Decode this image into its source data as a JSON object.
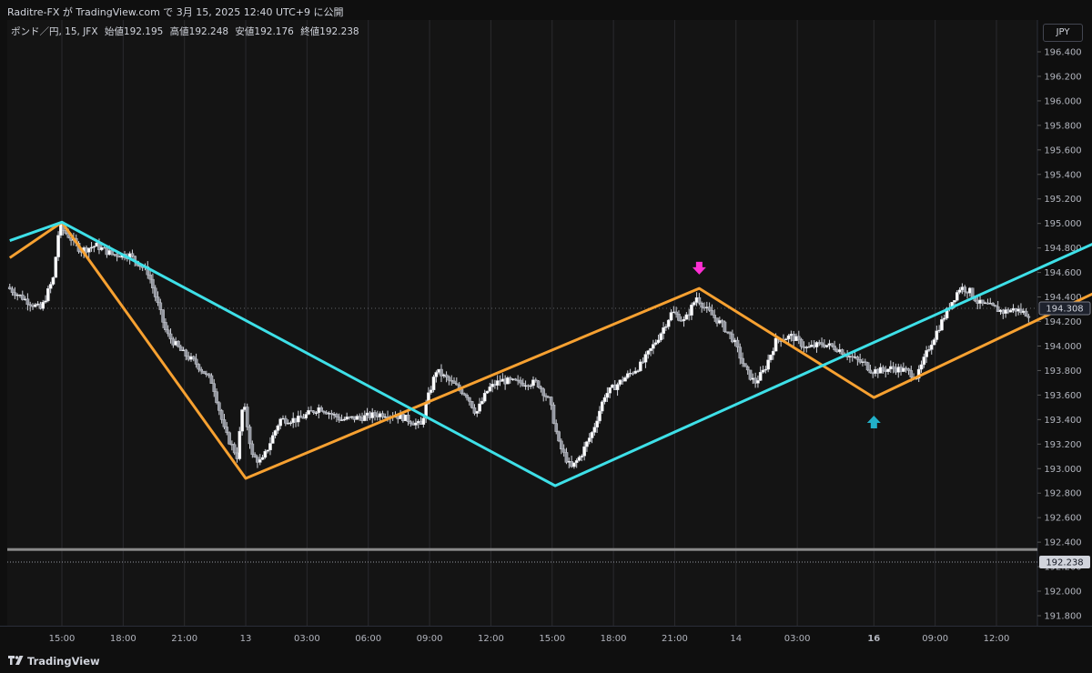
{
  "header": {
    "publish_info": "Raditre-FX が TradingView.com で 3月 15, 2025 12:40 UTC+9 に公開"
  },
  "legend": {
    "symbol": "ポンド／円, 15, JFX",
    "open": "始値192.195",
    "high": "高値192.248",
    "low": "安値192.176",
    "close": "終値192.238"
  },
  "currency_label": "JPY",
  "footer": {
    "brand": "TradingView"
  },
  "colors": {
    "background": "#141414",
    "grid": "#2a2a2e",
    "cyan_zigzag": "#3ee0e8",
    "orange_zigzag": "#f7a131",
    "marker_down": "#ff2fd4",
    "marker_up": "#22b0c8",
    "candle": "#d1d4dc",
    "hline": "#8a8a8a"
  },
  "chart_data": {
    "type": "candlestick",
    "symbol": "ポンド／円, 15, JFX",
    "ylim": [
      191.7,
      196.6
    ],
    "y_ticks": [
      "196.400",
      "196.200",
      "196.000",
      "195.800",
      "195.600",
      "195.400",
      "195.200",
      "195.000",
      "194.800",
      "194.600",
      "194.400",
      "194.200",
      "194.000",
      "193.800",
      "193.600",
      "193.400",
      "193.200",
      "193.000",
      "192.800",
      "192.600",
      "192.400",
      "192.200",
      "192.000",
      "191.800"
    ],
    "y_tick_values": [
      196.4,
      196.2,
      196.0,
      195.8,
      195.6,
      195.4,
      195.2,
      195.0,
      194.8,
      194.6,
      194.4,
      194.2,
      194.0,
      193.8,
      193.6,
      193.4,
      193.2,
      193.0,
      192.8,
      192.6,
      192.4,
      192.2,
      192.0,
      191.8
    ],
    "x_time_index_range": [
      -0.7,
      35.6
    ],
    "x_ticks": [
      {
        "label": "15:00",
        "t": 1.0,
        "bold": false
      },
      {
        "label": "18:00",
        "t": 3.0,
        "bold": false
      },
      {
        "label": "21:00",
        "t": 5.0,
        "bold": false
      },
      {
        "label": "13",
        "t": 7.0,
        "bold": false
      },
      {
        "label": "03:00",
        "t": 9.0,
        "bold": false
      },
      {
        "label": "06:00",
        "t": 11.0,
        "bold": false
      },
      {
        "label": "09:00",
        "t": 13.0,
        "bold": false
      },
      {
        "label": "12:00",
        "t": 15.0,
        "bold": false
      },
      {
        "label": "15:00",
        "t": 17.0,
        "bold": false
      },
      {
        "label": "18:00",
        "t": 19.0,
        "bold": false
      },
      {
        "label": "21:00",
        "t": 21.0,
        "bold": false
      },
      {
        "label": "14",
        "t": 23.0,
        "bold": false
      },
      {
        "label": "03:00",
        "t": 25.0,
        "bold": false
      },
      {
        "label": "16",
        "t": 27.5,
        "bold": true
      },
      {
        "label": "09:00",
        "t": 29.5,
        "bold": false
      },
      {
        "label": "12:00",
        "t": 31.5,
        "bold": false
      }
    ],
    "price_line_current": 194.308,
    "price_line_close": 192.238,
    "price_labels": [
      "194.308",
      "192.238"
    ],
    "horizontal_level": 192.34,
    "cyan_zigzag": [
      [
        -0.7,
        194.86
      ],
      [
        1.0,
        195.01
      ],
      [
        17.1,
        192.86
      ],
      [
        35.6,
        194.94
      ]
    ],
    "orange_zigzag": [
      [
        -0.7,
        194.72
      ],
      [
        1.0,
        195.01
      ],
      [
        7.0,
        192.92
      ],
      [
        21.8,
        194.47
      ],
      [
        27.5,
        193.58
      ],
      [
        35.6,
        194.54
      ]
    ],
    "markers": [
      {
        "type": "arrow-down",
        "t": 21.8,
        "y": 194.62
      },
      {
        "type": "arrow-up",
        "t": 27.5,
        "y": 193.38
      }
    ],
    "candles_per_tick": 12,
    "price_path": [
      [
        -0.7,
        194.48
      ],
      [
        0.0,
        194.36
      ],
      [
        0.4,
        194.3
      ],
      [
        0.8,
        194.55
      ],
      [
        1.0,
        194.98
      ],
      [
        1.3,
        194.9
      ],
      [
        1.7,
        194.78
      ],
      [
        2.2,
        194.82
      ],
      [
        2.7,
        194.75
      ],
      [
        3.3,
        194.74
      ],
      [
        3.9,
        194.6
      ],
      [
        4.5,
        194.1
      ],
      [
        5.0,
        193.95
      ],
      [
        5.5,
        193.85
      ],
      [
        6.0,
        193.7
      ],
      [
        6.4,
        193.3
      ],
      [
        6.8,
        193.1
      ],
      [
        7.0,
        193.55
      ],
      [
        7.3,
        193.1
      ],
      [
        7.6,
        193.05
      ],
      [
        8.2,
        193.4
      ],
      [
        8.8,
        193.4
      ],
      [
        9.5,
        193.5
      ],
      [
        10.2,
        193.4
      ],
      [
        10.9,
        193.42
      ],
      [
        11.6,
        193.45
      ],
      [
        12.2,
        193.42
      ],
      [
        12.8,
        193.35
      ],
      [
        13.0,
        193.55
      ],
      [
        13.3,
        193.8
      ],
      [
        13.8,
        193.7
      ],
      [
        14.3,
        193.6
      ],
      [
        14.6,
        193.45
      ],
      [
        15.0,
        193.65
      ],
      [
        15.4,
        193.72
      ],
      [
        16.0,
        193.7
      ],
      [
        16.6,
        193.7
      ],
      [
        17.0,
        193.55
      ],
      [
        17.3,
        193.2
      ],
      [
        17.7,
        193.0
      ],
      [
        18.0,
        193.1
      ],
      [
        18.4,
        193.3
      ],
      [
        18.8,
        193.6
      ],
      [
        19.5,
        193.75
      ],
      [
        20.0,
        193.85
      ],
      [
        20.5,
        194.05
      ],
      [
        21.0,
        194.28
      ],
      [
        21.4,
        194.2
      ],
      [
        21.8,
        194.4
      ],
      [
        22.1,
        194.3
      ],
      [
        22.6,
        194.18
      ],
      [
        23.0,
        194.05
      ],
      [
        23.4,
        193.8
      ],
      [
        23.7,
        193.7
      ],
      [
        24.0,
        193.8
      ],
      [
        24.4,
        194.05
      ],
      [
        24.9,
        194.08
      ],
      [
        25.4,
        193.98
      ],
      [
        25.9,
        194.02
      ],
      [
        26.4,
        193.98
      ],
      [
        26.9,
        193.9
      ],
      [
        27.3,
        193.85
      ],
      [
        27.5,
        193.8
      ],
      [
        27.8,
        193.8
      ],
      [
        28.2,
        193.82
      ],
      [
        28.6,
        193.8
      ],
      [
        29.0,
        193.75
      ],
      [
        29.4,
        194.0
      ],
      [
        29.8,
        194.2
      ],
      [
        30.1,
        194.35
      ],
      [
        30.4,
        194.48
      ],
      [
        30.7,
        194.45
      ],
      [
        31.0,
        194.35
      ],
      [
        31.4,
        194.32
      ],
      [
        31.8,
        194.28
      ],
      [
        32.2,
        194.3
      ],
      [
        32.6,
        194.26
      ]
    ]
  }
}
